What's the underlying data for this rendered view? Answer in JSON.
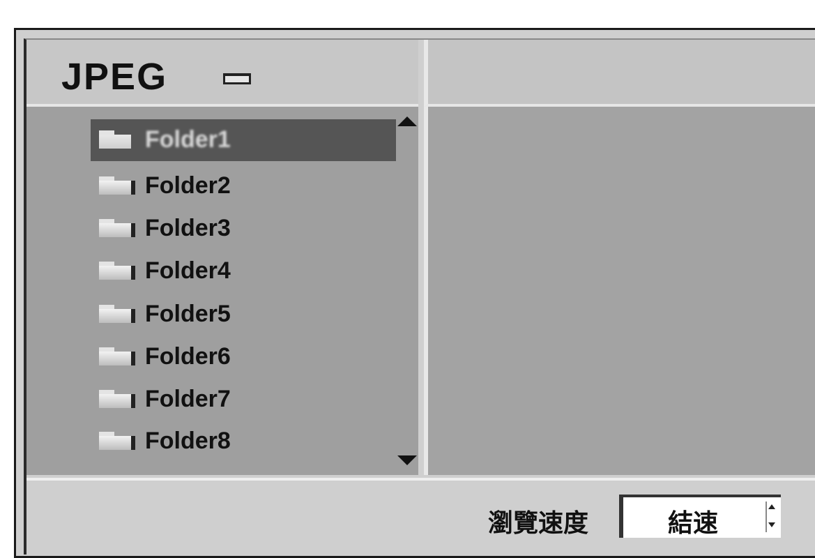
{
  "header": {
    "title": "JPEG",
    "title_icon": "folder-icon"
  },
  "list": {
    "items": [
      {
        "label": "Folder1",
        "selected": true,
        "icon": "folder-icon"
      },
      {
        "label": "Folder2",
        "selected": false,
        "icon": "folder-icon"
      },
      {
        "label": "Folder3",
        "selected": false,
        "icon": "folder-icon"
      },
      {
        "label": "Folder4",
        "selected": false,
        "icon": "folder-icon"
      },
      {
        "label": "Folder5",
        "selected": false,
        "icon": "folder-icon"
      },
      {
        "label": "Folder6",
        "selected": false,
        "icon": "folder-icon"
      },
      {
        "label": "Folder7",
        "selected": false,
        "icon": "folder-icon"
      },
      {
        "label": "Folder8",
        "selected": false,
        "icon": "folder-icon"
      }
    ]
  },
  "footer": {
    "label": "瀏覽速度",
    "select_value": "結速"
  },
  "colors": {
    "panel": "#9f9f9f",
    "selected": "#555555",
    "chrome": "#cfcfcf"
  }
}
